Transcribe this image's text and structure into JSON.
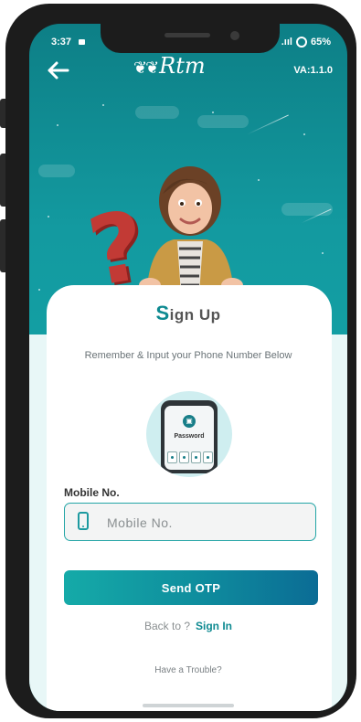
{
  "status_bar": {
    "time": "3:37",
    "battery": "65%"
  },
  "header": {
    "logo_text": "Rtm",
    "version": "VA:1.1.0"
  },
  "card": {
    "title_initial": "S",
    "title_rest": "ign Up",
    "subtitle": "Remember & Input your Phone Number Below",
    "illustration_label": "Password"
  },
  "form": {
    "mobile_label": "Mobile No.",
    "mobile_placeholder": "Mobile No.",
    "mobile_value": "",
    "send_button": "Send OTP"
  },
  "footer": {
    "back_prompt": "Back to ?",
    "sign_in_link": "Sign In",
    "trouble_link": "Have a Trouble?"
  },
  "colors": {
    "accent": "#0e8a91",
    "question_mark": "#c23a35",
    "button_start": "#15aaa8",
    "button_end": "#0b6c95"
  }
}
